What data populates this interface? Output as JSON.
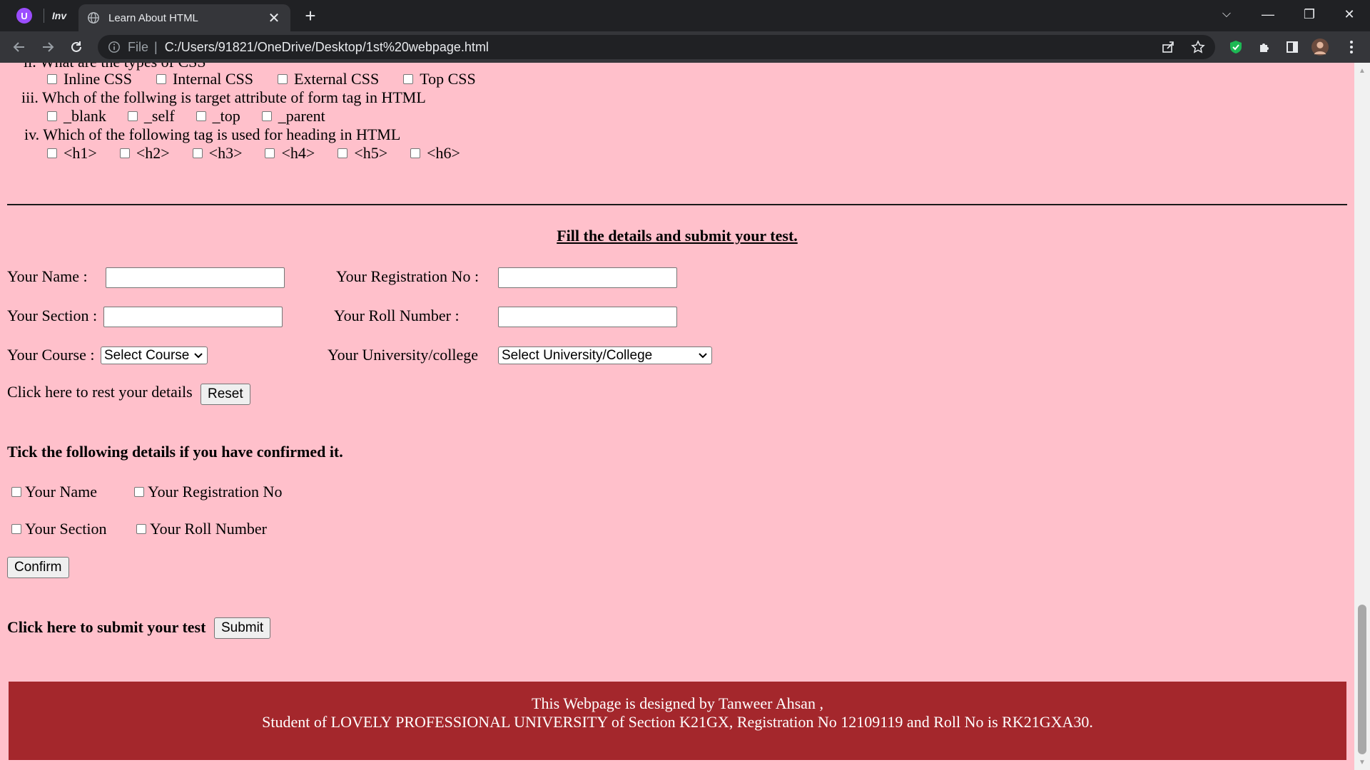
{
  "browser": {
    "pinned_tabs": [
      {
        "icon": "purple-circle-u-icon",
        "label": "U"
      },
      {
        "icon": "inv-icon",
        "label": "Inv"
      }
    ],
    "tab_title": "Learn About HTML",
    "tab_close": "✕",
    "new_tab": "+",
    "address_scheme": "File",
    "address_url": "C:/Users/91821/OneDrive/Desktop/1st%20webpage.html",
    "window_controls": [
      "⌵",
      "—",
      "❐",
      "✕"
    ]
  },
  "quiz": {
    "q2_partial": "ii. What are the types of CSS",
    "q2_options": [
      "Inline CSS",
      "Internal CSS",
      "External CSS",
      "Top CSS"
    ],
    "q3": "iii. Whch of the follwing is target attribute of form tag in HTML",
    "q3_options": [
      "_blank",
      "_self",
      "_top",
      "_parent"
    ],
    "q4": "iv. Which of the following tag is used for heading in HTML",
    "q4_options": [
      "<h1>",
      "<h2>",
      "<h3>",
      "<h4>",
      "<h5>",
      "<h6>"
    ]
  },
  "form": {
    "heading": "Fill the details and submit your test.",
    "name_label": "Your Name :",
    "reg_label": "Your Registration No :",
    "section_label": "Your Section :",
    "roll_label": "Your Roll Number :",
    "course_label": "Your Course :",
    "course_selected": "Select Course",
    "university_label": "Your University/college",
    "university_selected": "Select University/College",
    "reset_text": "Click here to rest your details",
    "reset_button": "Reset"
  },
  "confirm": {
    "heading": "Tick the following details if you have confirmed it.",
    "items": [
      "Your Name",
      "Your Registration No",
      "Your Section",
      "Your Roll Number"
    ],
    "button": "Confirm"
  },
  "submit": {
    "text": "Click here to submit your test",
    "button": "Submit"
  },
  "footer": {
    "line1": "This Webpage is designed by Tanweer Ahsan ,",
    "line2": "Student of LOVELY PROFESSIONAL UNIVERSITY of Section K21GX, Registration No 12109119 and Roll No is RK21GXA30."
  },
  "colors": {
    "page_background": "#ffc0cb",
    "footer_background": "#a4272c"
  }
}
